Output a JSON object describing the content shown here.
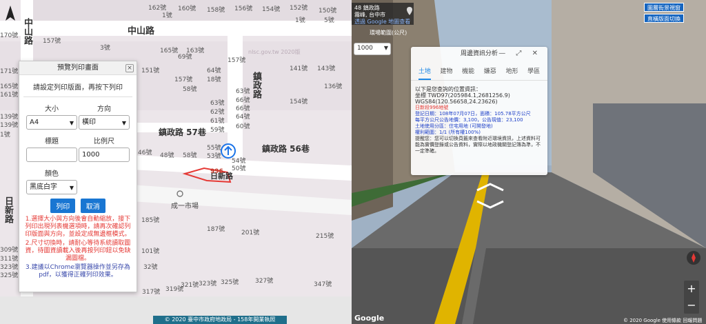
{
  "map": {
    "road_names": [
      "中山路",
      "中山路",
      "鎮政路",
      "鎮政路 57巷",
      "鎮政路 56巷",
      "日新路",
      "日新路"
    ],
    "house_numbers": [
      "162號",
      "160號",
      "158號",
      "156號",
      "154號",
      "152號",
      "150號",
      "1號",
      "165號",
      "163號",
      "1號",
      "5號",
      "3號",
      "170號",
      "157號",
      "151號",
      "157號",
      "171號",
      "165號",
      "161號",
      "139號",
      "139號",
      "1號",
      "69號",
      "64號",
      "18號",
      "157號",
      "63號",
      "66號",
      "66號",
      "64號",
      "63號",
      "62號",
      "61號",
      "60號",
      "59號",
      "58號",
      "55號",
      "53號",
      "54號",
      "50號",
      "48號",
      "46號",
      "58號",
      "141號",
      "143號",
      "136號",
      "154號",
      "185號",
      "187號",
      "201號",
      "215號",
      "101號",
      "32號",
      "317號",
      "319號",
      "321號",
      "323號",
      "325號",
      "327號",
      "347號",
      "309號",
      "311號",
      "323號",
      "325號"
    ],
    "watermark": "nlsc.gov.tw 2020版",
    "parcel_label": "996",
    "market_label": "成一市場",
    "copyright": "© 2020 臺中市政府地政局 - 158年開業執照"
  },
  "print_dialog": {
    "title": "預覽列印畫面",
    "close_label": "×",
    "subtitle": "請設定列印版面，再按下列印",
    "size_label": "大小",
    "size_value": "A4",
    "direction_label": "方向",
    "direction_value": "橫印",
    "title_label": "標題",
    "title_value": "",
    "scale_label": "比例尺",
    "scale_value": "1000",
    "color_label": "顏色",
    "color_value": "黑底白字",
    "print_button": "列印",
    "cancel_button": "取消",
    "note1": "1.選擇大小與方向後會自動縮放，接下列印出現列表機選項時，請再次確認列印版面與方向，並設定成無邊框模式。",
    "note2": "2.尺寸切換時，請耐心等待系統讀取圖資，待圖資讀載入後再按列印鈕以免缺漏圖檔。",
    "note3": "3.建議以Chrome瀏覽器操作並另存為pdf，以獲得正確列印效果。"
  },
  "street_view": {
    "address_line1": "48 鎮政路",
    "address_line2": "霧峰, 台中市",
    "address_link": "透過 Google 地圖查看",
    "distance_caption": "環場範圍(公尺)",
    "distance_value": "1000",
    "btn_top1": "圖層街景視窗",
    "btn_top2": "直橫版面切換",
    "logo": "Google",
    "copyright": "© 2020 Google  使用條款  回報問題"
  },
  "info_panel": {
    "title": "周邊資訊分析",
    "window_controls": "— ⤢ ✕",
    "tabs": [
      "土地",
      "建物",
      "機能",
      "嫌惡",
      "地形",
      "學區"
    ],
    "intro": "以下是您查詢的位置資訊：",
    "coord1": "坐標 TWD97(205984.1,2681256.9)",
    "coord2": "WGS84(120.56658,24.23626)",
    "parcel": "日新段996地號",
    "line1": "登記日期：108年07月07日，面積：105.78平方公尺",
    "line2": "每平方公尺公告地價：3,100，公告現值：23,100",
    "line3": "土地使用分區：住宅用地 (可開發地)",
    "line4": "權利範圍：1/1 (所有權100%)",
    "line5": "提醒您：您可以切換頁籤來查看附近環境資訊，上述資料可能為實價登錄或公告資料，實際以地政機關登記簿為準，不一定準確。"
  }
}
